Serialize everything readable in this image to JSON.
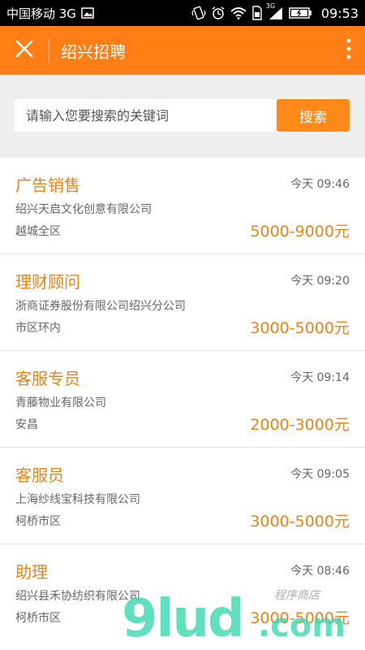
{
  "status_bar": {
    "carrier": "中国移动 3G",
    "network_label": "3G",
    "time": "09:53"
  },
  "header": {
    "title": "绍兴招聘"
  },
  "search": {
    "placeholder": "请输入您要搜索的关键词",
    "button_label": "搜索"
  },
  "jobs": [
    {
      "title": "广告销售",
      "time": "今天 09:46",
      "company": "绍兴天启文化创意有限公司",
      "location": "越城全区",
      "salary": "5000-9000元"
    },
    {
      "title": "理财顾问",
      "time": "今天 09:20",
      "company": "浙商证券股份有限公司绍兴分公司",
      "location": "市区环内",
      "salary": "3000-5000元"
    },
    {
      "title": "客服专员",
      "time": "今天 09:14",
      "company": "青藤物业有限公司",
      "location": "安昌",
      "salary": "2000-3000元"
    },
    {
      "title": "客服员",
      "time": "今天 09:05",
      "company": "上海纱线宝科技有限公司",
      "location": "柯桥市区",
      "salary": "3000-5000元"
    },
    {
      "title": "助理",
      "time": "今天 08:46",
      "company": "绍兴县禾协纺织有限公司",
      "location": "柯桥市区",
      "salary": "3000-5000元"
    }
  ],
  "watermark": {
    "main": "9lud",
    "domain": ".com",
    "tag": "程序商店"
  },
  "colors": {
    "accent": "#ff7e15",
    "title_text": "#e8841a",
    "secondary_text": "#666666",
    "search_bg": "#efefef"
  },
  "icons": {
    "close": "close-icon",
    "more": "more-vertical-icon",
    "image": "image-icon",
    "vibrate": "vibrate-icon",
    "alarm": "alarm-icon",
    "wifi": "wifi-icon",
    "sim": "sim-card-icon",
    "signal": "signal-icon",
    "battery": "battery-icon"
  }
}
